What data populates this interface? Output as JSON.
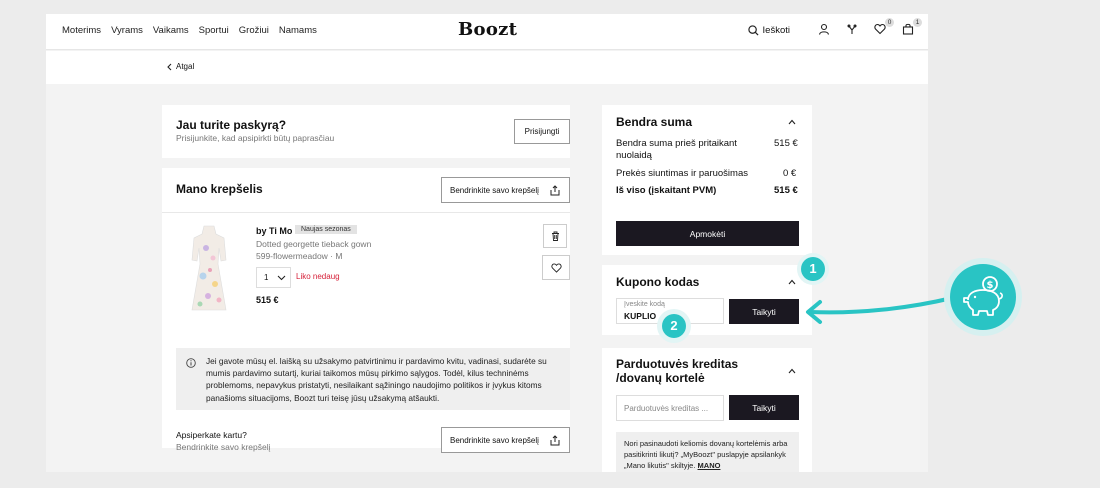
{
  "header": {
    "nav": [
      "Moterims",
      "Vyrams",
      "Vaikams",
      "Sportui",
      "Grožiui",
      "Namams"
    ],
    "logo": "Boozt",
    "search_label": "Ieškoti",
    "wishlist_count": "0",
    "cart_count": "1"
  },
  "back_label": "Atgal",
  "account": {
    "title": "Jau turite paskyrą?",
    "subtitle": "Prisijunkite, kad apsipirkti būtų paprasčiau",
    "login_button": "Prisijungti"
  },
  "cart": {
    "title": "Mano krepšelis",
    "share_button": "Bendrinkite savo krepšelį",
    "item": {
      "brand": "by Ti Mo",
      "tag": "Naujas sezonas",
      "name": "Dotted georgette tieback gown",
      "variant": "599-flowermeadow · M",
      "quantity": "1",
      "stock_note": "Liko nedaug",
      "price": "515 €"
    },
    "info_text": "Jei gavote mūsų el. laišką su užsakymo patvirtinimu ir pardavimo kvitu, vadinasi, sudarėte su mumis pardavimo sutartį, kuriai taikomos mūsų pirkimo sąlygos. Todėl, kilus techninėms problemoms, nepavykus pristatyti, nesilaikant sąžiningo naudojimo politikos ir įvykus kitoms panašioms situacijoms, Boozt turi teisę jūsų užsakymą atšaukti.",
    "together_title": "Apsiperkate kartu?",
    "together_subtitle": "Bendrinkite savo krepšelį",
    "together_button": "Bendrinkite savo krepšelį"
  },
  "summary": {
    "title": "Bendra suma",
    "rows": [
      {
        "label": "Bendra suma prieš pritaikant nuolaidą",
        "value": "515 €"
      },
      {
        "label": "Prekės siuntimas ir paruošimas",
        "value": "0 €"
      },
      {
        "label": "Iš viso (įskaitant PVM)",
        "value": "515 €"
      }
    ],
    "pay_button": "Apmokėti"
  },
  "coupon": {
    "title": "Kupono kodas",
    "input_label": "Įveskite kodą",
    "input_value": "KUPLIO",
    "apply_button": "Taikyti"
  },
  "credit": {
    "title": "Parduotuvės kreditas /dovanų kortelė",
    "placeholder": "Parduotuvės kreditas ...",
    "apply_button": "Taikyti",
    "note": "Nori pasinaudoti keliomis dovanų kortelėmis arba pasitikrinti likutį? „MyBoozt\" puslapyje apsilankyk „Mano likutis\" skiltyje.",
    "note_link": "MANO"
  },
  "annotations": {
    "step1": "1",
    "step2": "2",
    "accent": "#29c4c4"
  }
}
